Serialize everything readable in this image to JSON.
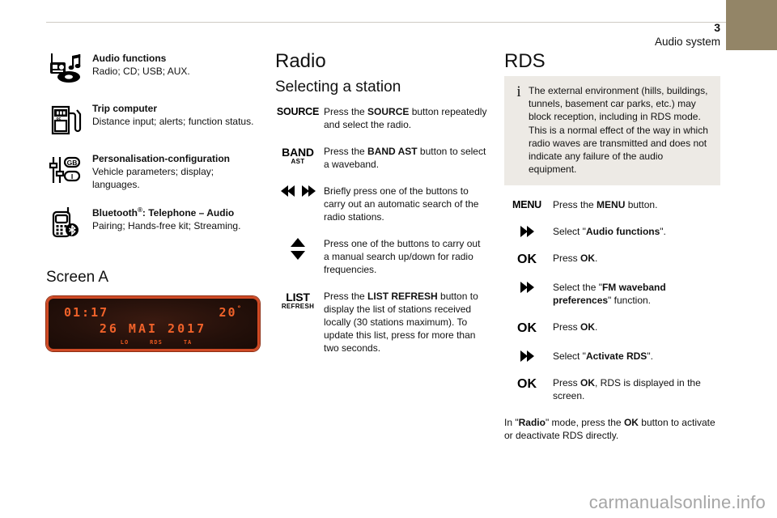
{
  "header": {
    "page_number": "3",
    "section_name": "Audio system",
    "accent_color": "#938567"
  },
  "left_column": {
    "features": [
      {
        "icon": "radio-cd-music-icon",
        "title": "Audio functions",
        "desc": "Radio; CD; USB; AUX."
      },
      {
        "icon": "fuel-pump-icon",
        "title": "Trip computer",
        "desc": "Distance input; alerts; function status."
      },
      {
        "icon": "sliders-language-icon",
        "title": "Personalisation-configuration",
        "desc": "Vehicle parameters; display; languages."
      },
      {
        "icon": "mobile-phone-bluetooth-icon",
        "title_main": "Bluetooth",
        "title_sup": "®",
        "title_rest": ": Telephone – Audio",
        "desc": "Pairing; Hands-free kit; Streaming."
      }
    ],
    "screen_a": {
      "heading": "Screen A",
      "lcd": {
        "time": "01:17",
        "temperature": "20",
        "degree": "°",
        "date": "26 MAI 2017",
        "flags": [
          "LO",
          "RDS",
          "TA"
        ],
        "bezel_color": "#cf4a25",
        "text_color": "#f0622a"
      }
    }
  },
  "middle_column": {
    "title": "Radio",
    "subtitle": "Selecting a station",
    "steps": [
      {
        "key_type": "label",
        "key_label": "SOURCE",
        "text_parts": [
          {
            "t": "Press the ",
            "b": false
          },
          {
            "t": "SOURCE",
            "b": true
          },
          {
            "t": " button repeatedly and select the radio.",
            "b": false
          }
        ]
      },
      {
        "key_type": "label-sub",
        "key_label": "BAND",
        "key_sub": "AST",
        "text_parts": [
          {
            "t": "Press the ",
            "b": false
          },
          {
            "t": "BAND AST",
            "b": true
          },
          {
            "t": " button to select a waveband.",
            "b": false
          }
        ]
      },
      {
        "key_type": "arrows-lr",
        "text_parts": [
          {
            "t": "Briefly press one of the buttons to carry out an automatic search of the radio stations.",
            "b": false
          }
        ]
      },
      {
        "key_type": "arrows-updown",
        "text_parts": [
          {
            "t": "Press one of the buttons to carry out a manual search up/down for radio frequencies.",
            "b": false
          }
        ]
      },
      {
        "key_type": "label-sub",
        "key_label": "LIST",
        "key_sub": "REFRESH",
        "text_parts": [
          {
            "t": "Press the ",
            "b": false
          },
          {
            "t": "LIST REFRESH",
            "b": true
          },
          {
            "t": " button to display the list of stations received locally (30 stations maximum). To update this list, press for more than two seconds.",
            "b": false
          }
        ]
      }
    ]
  },
  "right_column": {
    "title": "RDS",
    "info_box": {
      "icon": "info-icon",
      "text": "The external environment (hills, buildings, tunnels, basement car parks, etc.) may block reception, including in RDS mode. This is a normal effect of the way in which radio waves are transmitted and does not indicate any failure of the audio equipment.",
      "background_color": "#edeae5"
    },
    "steps": [
      {
        "key_type": "label",
        "key_label": "MENU",
        "text_parts": [
          {
            "t": "Press the ",
            "b": false
          },
          {
            "t": "MENU",
            "b": true
          },
          {
            "t": " button.",
            "b": false
          }
        ]
      },
      {
        "key_type": "arrows-rr",
        "text_parts": [
          {
            "t": "Select \"",
            "b": false
          },
          {
            "t": "Audio functions",
            "b": true
          },
          {
            "t": "\".",
            "b": false
          }
        ]
      },
      {
        "key_type": "ok",
        "key_label": "OK",
        "text_parts": [
          {
            "t": "Press ",
            "b": false
          },
          {
            "t": "OK",
            "b": true
          },
          {
            "t": ".",
            "b": false
          }
        ]
      },
      {
        "key_type": "arrows-rr",
        "text_parts": [
          {
            "t": "Select the \"",
            "b": false
          },
          {
            "t": "FM waveband preferences",
            "b": true
          },
          {
            "t": "\" function.",
            "b": false
          }
        ]
      },
      {
        "key_type": "ok",
        "key_label": "OK",
        "text_parts": [
          {
            "t": "Press ",
            "b": false
          },
          {
            "t": "OK",
            "b": true
          },
          {
            "t": ".",
            "b": false
          }
        ]
      },
      {
        "key_type": "arrows-rr",
        "text_parts": [
          {
            "t": "Select \"",
            "b": false
          },
          {
            "t": "Activate RDS",
            "b": true
          },
          {
            "t": "\".",
            "b": false
          }
        ]
      },
      {
        "key_type": "ok",
        "key_label": "OK",
        "text_parts": [
          {
            "t": "Press ",
            "b": false
          },
          {
            "t": "OK",
            "b": true
          },
          {
            "t": ", RDS is displayed in the screen.",
            "b": false
          }
        ]
      }
    ],
    "closing_note_parts": [
      {
        "t": "In \"",
        "b": false
      },
      {
        "t": "Radio",
        "b": true
      },
      {
        "t": "\" mode, press the ",
        "b": false
      },
      {
        "t": "OK",
        "b": true
      },
      {
        "t": " button to activate or deactivate RDS directly.",
        "b": false
      }
    ]
  },
  "watermark": "carmanualsonline.info"
}
